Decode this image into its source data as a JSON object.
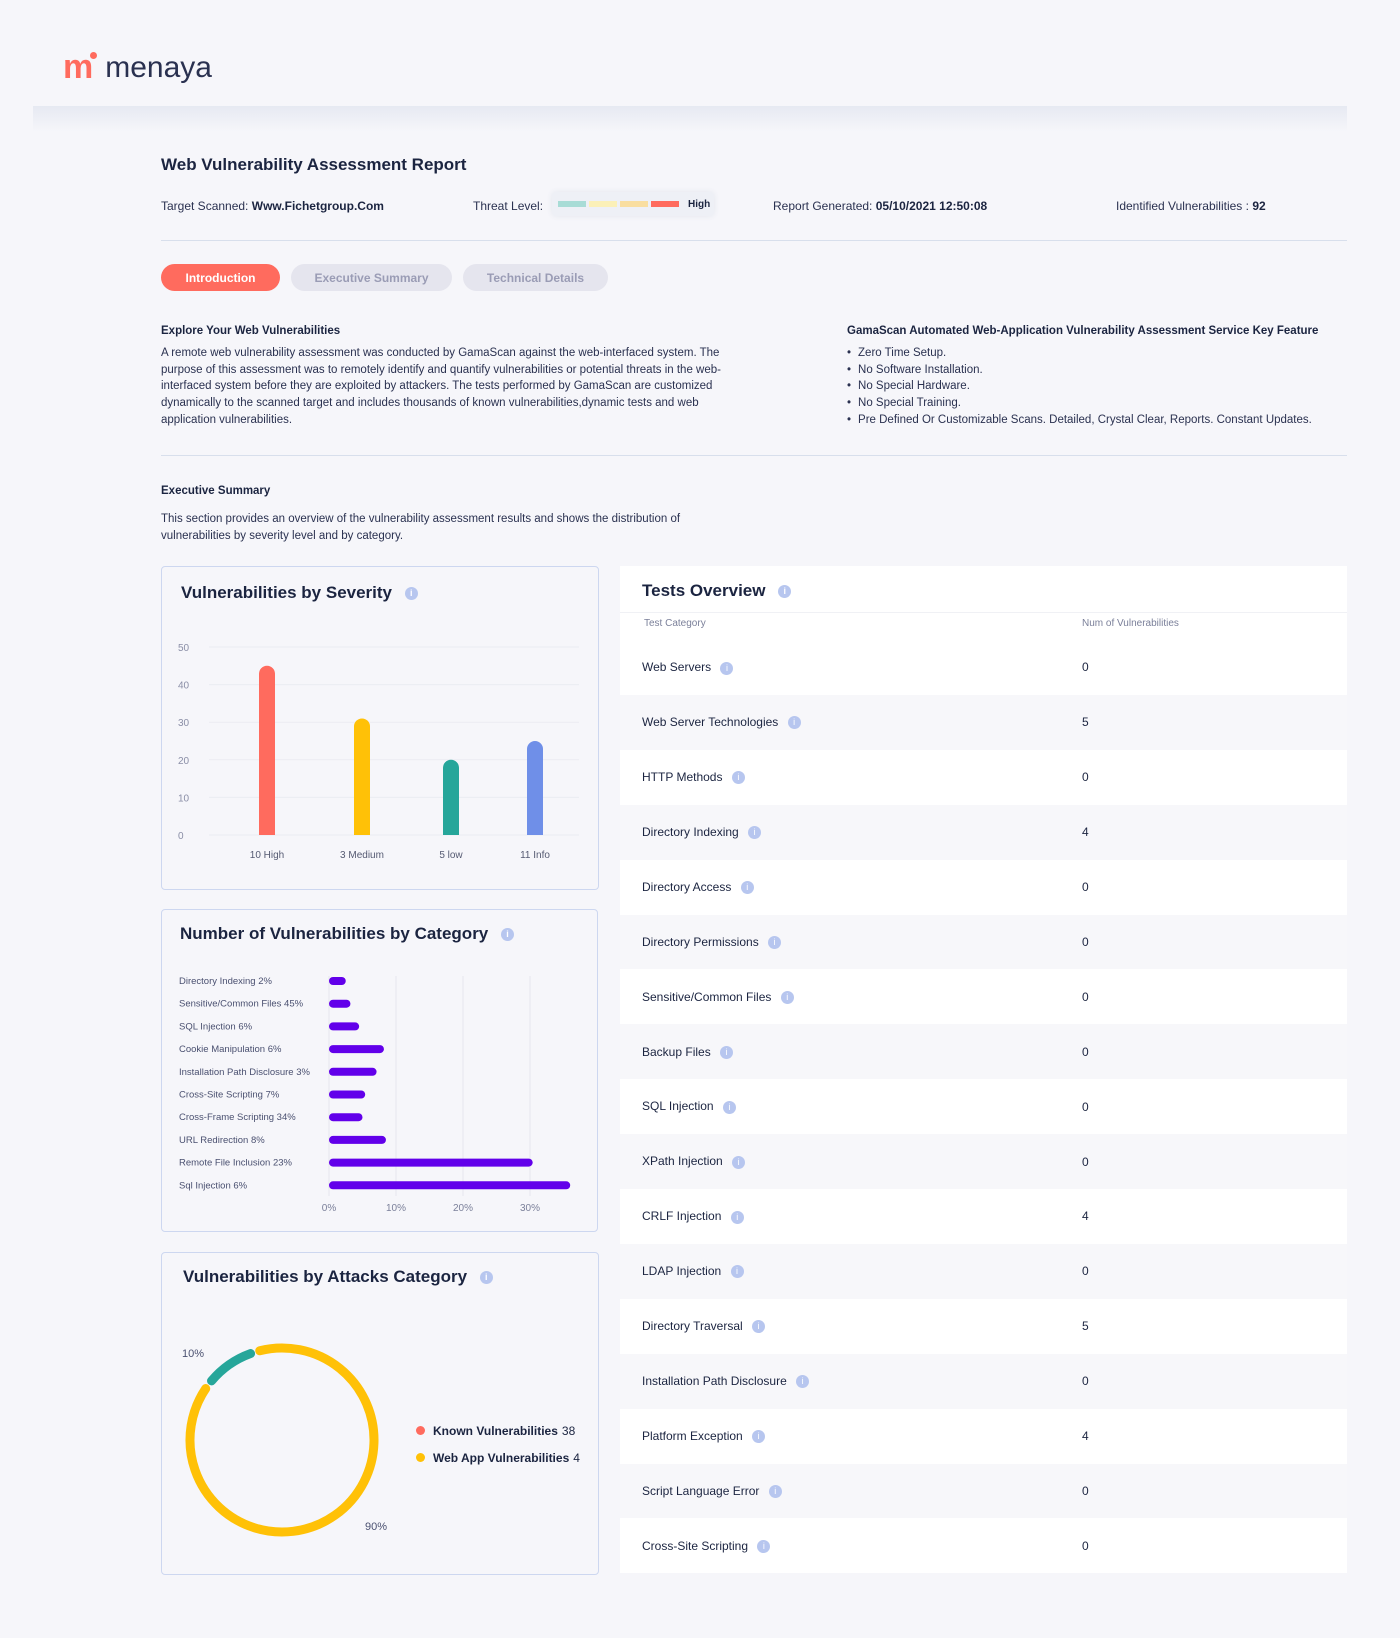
{
  "brand": {
    "name": "menaya",
    "mark": "m"
  },
  "report": {
    "title": "Web Vulnerability Assessment Report",
    "target_label": "Target Scanned:",
    "target_value": "Www.Fichetgroup.Com",
    "threat_label": "Threat Level:",
    "threat_value": "High",
    "threat_colors": [
      "#a8dcd6",
      "#fbf0b8",
      "#f9dea0",
      "#ff6b5e"
    ],
    "generated_label": "Report Generated:",
    "generated_value": "05/10/2021 12:50:08",
    "identified_label": "Identified Vulnerabilities :",
    "identified_value": "92"
  },
  "tabs": [
    {
      "label": "Introduction",
      "active": true
    },
    {
      "label": "Executive Summary",
      "active": false
    },
    {
      "label": "Technical Details",
      "active": false
    }
  ],
  "intro": {
    "heading": "Explore Your Web Vulnerabilities",
    "text": "A remote web vulnerability assessment was conducted by GamaScan against the web-interfaced system. The purpose of this assessment was to remotely identify and quantify vulnerabilities or potential threats in the web-interfaced system before they are exploited by attackers. The tests performed by GamaScan are customized dynamically to the scanned target and includes thousands of known vulnerabilities,dynamic tests and web application vulnerabilities.",
    "features_heading": "GamaScan Automated Web-Application Vulnerability Assessment Service Key Feature",
    "features": [
      "Zero Time Setup.",
      "No Software Installation.",
      "No Special Hardware.",
      "No Special Training.",
      "Pre Defined Or Customizable Scans. Detailed, Crystal Clear, Reports. Constant Updates."
    ]
  },
  "exec": {
    "heading": "Executive Summary",
    "text": "This section provides an overview of the vulnerability assessment results and shows the distribution of vulnerabilities by severity level and by category."
  },
  "chart_data": [
    {
      "type": "bar",
      "title": "Vulnerabilities by Severity",
      "categories": [
        "10 High",
        "3 Medium",
        "5 low",
        "11 Info"
      ],
      "values": [
        45,
        31,
        20,
        25
      ],
      "colors": [
        "#ff6b5e",
        "#ffc107",
        "#26a69a",
        "#6f8fe8"
      ],
      "ylim": [
        0,
        50
      ],
      "yticks": [
        "0",
        "10",
        "20",
        "30",
        "40",
        "50"
      ],
      "grid": true
    },
    {
      "type": "bar",
      "orientation": "horizontal",
      "title": "Number of Vulnerabilities by Category",
      "categories": [
        "Directory Indexing 2%",
        "Sensitive/Common Files 45%",
        "SQL Injection 6%",
        "Cookie Manipulation 6%",
        "Installation Path Disclosure 3%",
        "Cross-Site Scripting 7%",
        "Cross-Frame Scripting 34%",
        "URL Redirection 8%",
        "Remote File Inclusion 23%",
        "Sql Injection 6%"
      ],
      "values": [
        2.5,
        3.2,
        4.5,
        8.2,
        7.1,
        5.4,
        5.0,
        8.5,
        30.4,
        36.0
      ],
      "color": "#6200ea",
      "xticks": [
        "0%",
        "10%",
        "20%",
        "30%"
      ],
      "xlim": [
        0,
        30
      ],
      "grid": true
    },
    {
      "type": "pie",
      "style": "donut",
      "title": "Vulnerabilities by Attacks Category",
      "slices": [
        {
          "label": "10%",
          "value": 10,
          "color": "#26a69a"
        },
        {
          "label": "90%",
          "value": 90,
          "color": "#ffc107"
        }
      ],
      "legend": [
        {
          "name": "Known Vulnerabilities",
          "count": "38",
          "color": "#ff6b5e"
        },
        {
          "name": "Web App Vulnerabilities",
          "count": "4",
          "color": "#ffc107"
        }
      ],
      "legend_position": "right"
    }
  ],
  "tests": {
    "title": "Tests Overview",
    "col1": "Test Category",
    "col2": "Num of Vulnerabilities",
    "rows": [
      {
        "name": "Web Servers",
        "count": "0"
      },
      {
        "name": "Web Server Technologies",
        "count": "5"
      },
      {
        "name": "HTTP Methods",
        "count": "0"
      },
      {
        "name": "Directory Indexing",
        "count": "4"
      },
      {
        "name": "Directory Access",
        "count": "0"
      },
      {
        "name": "Directory Permissions",
        "count": "0"
      },
      {
        "name": "Sensitive/Common Files",
        "count": "0"
      },
      {
        "name": "Backup Files",
        "count": "0"
      },
      {
        "name": "SQL Injection",
        "count": "0"
      },
      {
        "name": "XPath Injection",
        "count": "0"
      },
      {
        "name": "CRLF Injection",
        "count": "4"
      },
      {
        "name": "LDAP Injection",
        "count": "0"
      },
      {
        "name": "Directory Traversal",
        "count": "5"
      },
      {
        "name": "Installation Path Disclosure",
        "count": "0"
      },
      {
        "name": "Platform Exception",
        "count": "4"
      },
      {
        "name": "Script Language Error",
        "count": "0"
      },
      {
        "name": "Cross-Site Scripting",
        "count": "0"
      }
    ]
  },
  "info_glyph": "i"
}
